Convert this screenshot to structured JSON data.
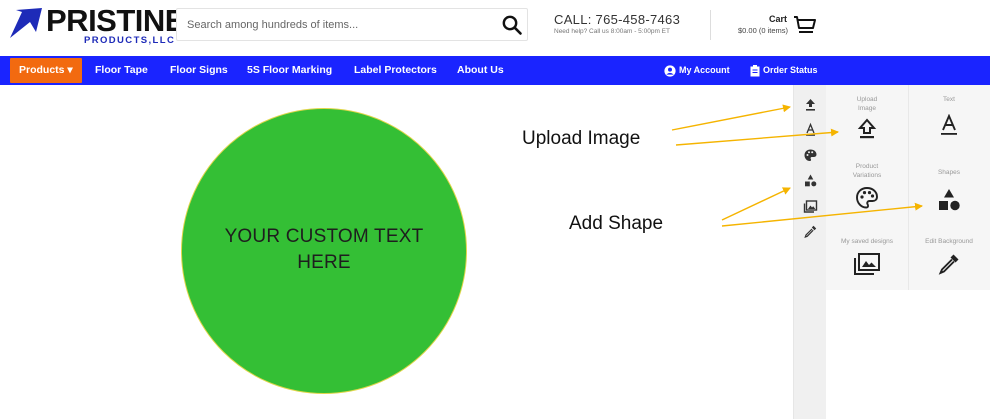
{
  "brand": {
    "name": "PRISTINE",
    "subtitle": "PRODUCTS,LLC"
  },
  "search": {
    "placeholder": "Search among hundreds of items..."
  },
  "contact": {
    "call": "CALL: 765-458-7463",
    "hours": "Need help? Call us 8:00am - 5:00pm ET"
  },
  "cart": {
    "label": "Cart",
    "summary": "$0.00 (0 items)"
  },
  "nav": {
    "products": "Products ▾",
    "items": [
      "Floor Tape",
      "Floor Signs",
      "5S Floor Marking",
      "Label Protectors",
      "About Us"
    ],
    "account": "My Account",
    "order_status": "Order Status"
  },
  "design": {
    "text_line1": "YOUR CUSTOM TEXT",
    "text_line2": "HERE",
    "fill_color": "#34bf35"
  },
  "annotations": {
    "upload": "Upload Image",
    "shape": "Add Shape",
    "arrow_color": "#f5b400"
  },
  "toolbar_icons": [
    "upload-icon",
    "text-icon",
    "palette-icon",
    "shapes-icon",
    "gallery-icon",
    "eyedropper-icon"
  ],
  "tools": {
    "upload": {
      "line1": "Upload",
      "line2": "Image"
    },
    "text": {
      "line1": "Text"
    },
    "variations": {
      "line1": "Product",
      "line2": "Variations"
    },
    "shapes": {
      "line1": "Shapes"
    },
    "saved": {
      "line1": "My saved designs"
    },
    "background": {
      "line1": "Edit Background"
    }
  },
  "colors": {
    "nav_blue": "#1a24ff",
    "products_orange": "#f26a10",
    "logo_blue": "#1e2bb8"
  }
}
